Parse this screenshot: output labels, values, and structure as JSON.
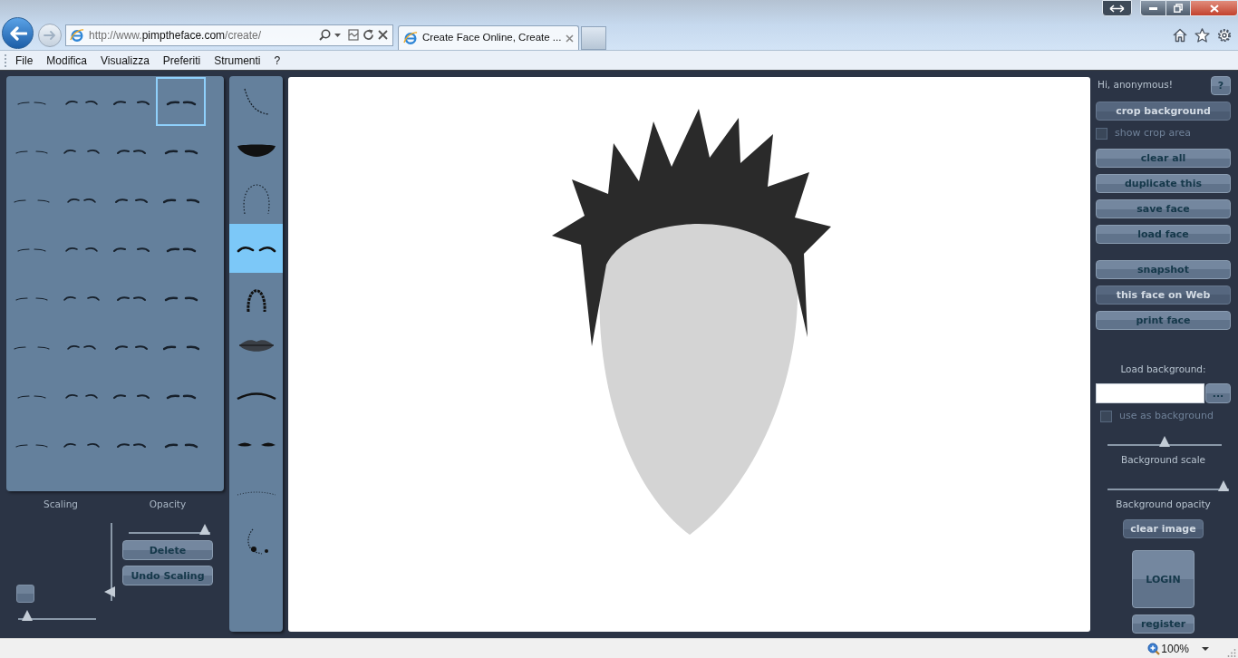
{
  "browser": {
    "url_parts": [
      "http://www.",
      "pimptheface.com",
      "/create/"
    ],
    "tab_title": "Create Face Online, Create ...",
    "menu": [
      "File",
      "Modifica",
      "Visualizza",
      "Preferiti",
      "Strumenti",
      "?"
    ]
  },
  "left_panel": {
    "palette": [
      {
        "selected": false
      },
      {
        "selected": false
      },
      {
        "selected": false
      },
      {
        "selected": true
      },
      {
        "selected": false
      },
      {
        "selected": false
      },
      {
        "selected": false
      },
      {
        "selected": false
      },
      {
        "selected": false
      },
      {
        "selected": false
      },
      {
        "selected": false
      },
      {
        "selected": false
      },
      {
        "selected": false
      },
      {
        "selected": false
      },
      {
        "selected": false
      },
      {
        "selected": false
      },
      {
        "selected": false
      },
      {
        "selected": false
      },
      {
        "selected": false
      },
      {
        "selected": false
      },
      {
        "selected": false
      },
      {
        "selected": false
      },
      {
        "selected": false
      },
      {
        "selected": false
      },
      {
        "selected": false
      },
      {
        "selected": false
      },
      {
        "selected": false
      },
      {
        "selected": false
      },
      {
        "selected": false
      },
      {
        "selected": false
      },
      {
        "selected": false
      },
      {
        "selected": false
      }
    ],
    "scaling": {
      "label": "Scaling",
      "vertical_slider": {
        "level": 0.05
      },
      "horizontal_slider": {
        "level": 0.05
      }
    },
    "opacity": {
      "label": "Opacity",
      "slider": {
        "level": 1
      }
    },
    "buttons": [
      "Delete",
      "Undo Scaling"
    ]
  },
  "categories": [
    {
      "selected": false
    },
    {
      "selected": false
    },
    {
      "selected": false
    },
    {
      "selected": true
    },
    {
      "selected": false
    },
    {
      "selected": false
    },
    {
      "selected": false
    },
    {
      "selected": false
    },
    {
      "selected": false
    },
    {
      "selected": false
    }
  ],
  "right_panel": {
    "greeting": "Hi, anonymous!",
    "help_button": "?",
    "crop_button": {
      "label": "crop background",
      "disabled": true
    },
    "show_crop_area": {
      "label": "show crop area",
      "checked": false,
      "disabled": true
    },
    "face_buttons": [
      {
        "label": "clear all",
        "disabled": false
      },
      {
        "label": "duplicate this",
        "disabled": false
      },
      {
        "label": "save face",
        "disabled": false
      },
      {
        "label": "load face",
        "disabled": false
      }
    ],
    "share_buttons": [
      {
        "label": "snapshot",
        "disabled": false
      },
      {
        "label": "this face on Web",
        "disabled": true
      },
      {
        "label": "print face",
        "disabled": false
      }
    ],
    "background": {
      "label": "Load background:",
      "browse_button": "...",
      "use_as_background": {
        "label": "use as background",
        "checked": false,
        "disabled": true
      },
      "scale": {
        "label": "Background scale",
        "level": 0.5
      },
      "opacity": {
        "label": "Background opacity",
        "level": 1
      },
      "clear_button": {
        "label": "clear image",
        "disabled": true
      }
    },
    "login_button": "LOGIN",
    "register_button": "register"
  },
  "status_bar": {
    "zoom": "100%"
  }
}
